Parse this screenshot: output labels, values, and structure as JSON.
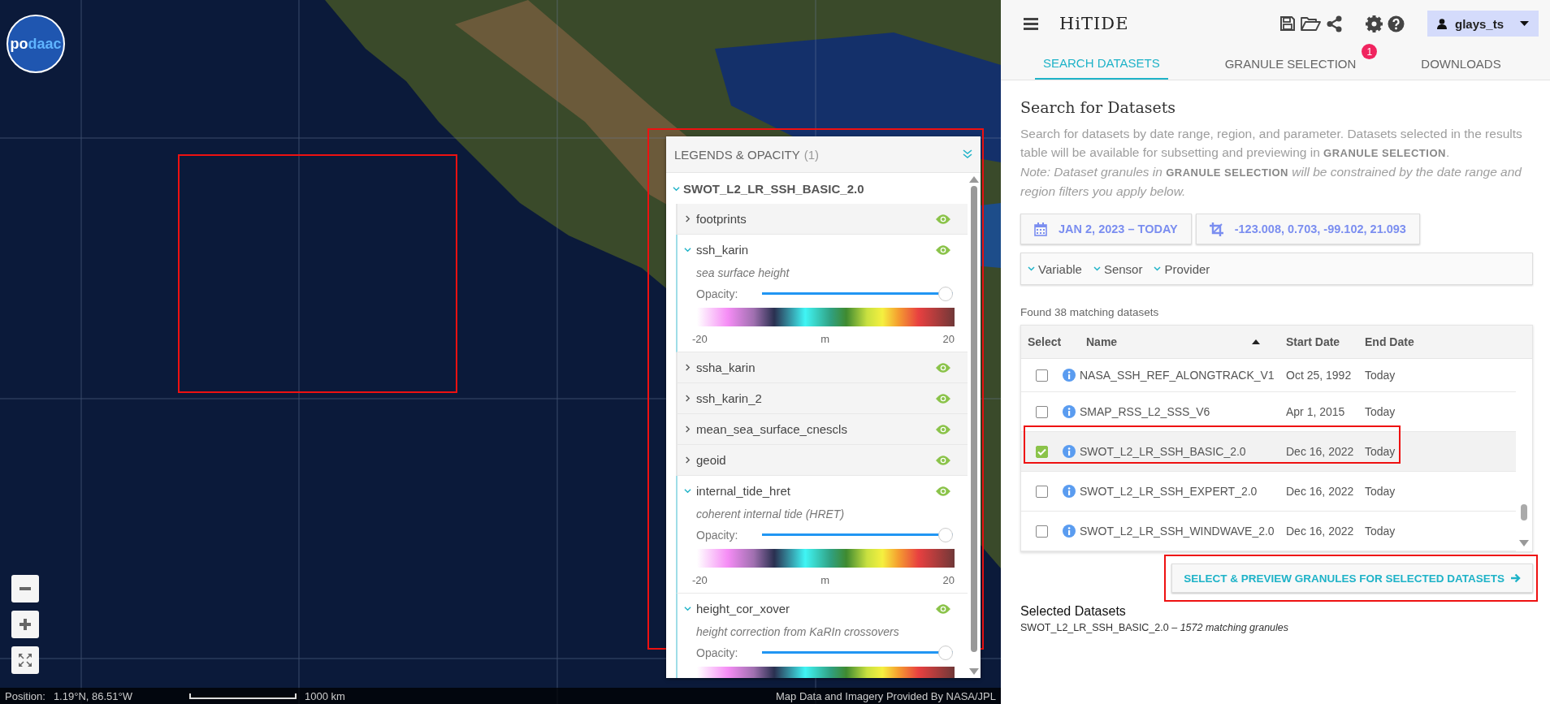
{
  "map": {
    "logo": [
      "po",
      "daac"
    ],
    "legend": {
      "title": "LEGENDS & OPACITY",
      "count": "(1)",
      "dataset": {
        "name": "SWOT_L2_LR_SSH_BASIC_2.0",
        "expanded": true
      },
      "layers": [
        {
          "name": "footprints",
          "expanded": false
        },
        {
          "name": "ssh_karin",
          "expanded": true,
          "description": "sea surface height",
          "opacity_label": "Opacity:",
          "level": 1,
          "min": "-20",
          "unit": "m",
          "max": "20"
        },
        {
          "name": "ssha_karin",
          "expanded": false
        },
        {
          "name": "ssh_karin_2",
          "expanded": false
        },
        {
          "name": "mean_sea_surface_cnescls",
          "expanded": false
        },
        {
          "name": "geoid",
          "expanded": false
        },
        {
          "name": "internal_tide_hret",
          "expanded": true,
          "description": "coherent internal tide (HRET)",
          "opacity_label": "Opacity:",
          "level": 1,
          "min": "-20",
          "unit": "m",
          "max": "20"
        },
        {
          "name": "height_cor_xover",
          "expanded": true,
          "description": "height correction from KaRIn crossovers",
          "opacity_label": "Opacity:",
          "level": 1
        }
      ]
    },
    "status_bar": {
      "position_label": "Position:",
      "position": "1.19°N, 86.51°W",
      "scale": "1000 km",
      "attribution": "Map Data and Imagery Provided By NASA/JPL"
    }
  },
  "header": {
    "title": "HiTIDE",
    "user": "glays_ts"
  },
  "tabs": [
    {
      "label": "SEARCH DATASETS",
      "selected": true
    },
    {
      "label": "GRANULE SELECTION",
      "selected": false,
      "badge": "1"
    },
    {
      "label": "DOWNLOADS",
      "selected": false
    }
  ],
  "search": {
    "title": "Search for Datasets",
    "description": "Search for datasets by date range, region, and parameter. Datasets selected in the results table will be available for subsetting and previewing in **GRANULE SELECTION**.",
    "note": "Note: Dataset granules in **GRANULE SELECTION** will be constrained by the date range and region filters you apply below.",
    "date_range": "JAN 2, 2023 – TODAY",
    "region": "-123.008, 0.703, -99.102, 21.093",
    "facets": [
      "Variable",
      "Sensor",
      "Provider"
    ]
  },
  "results": {
    "count": "Found 38 matching datasets",
    "columns": [
      "Select",
      "Name",
      "Start Date",
      "End Date"
    ],
    "rows": [
      {
        "name": "NASA_SSH_REF_ALONGTRACK_V1",
        "start": "Oct 25, 1992",
        "end": "Today",
        "checked": false
      },
      {
        "name": "SMAP_RSS_L2_SSS_V6",
        "start": "Apr 1, 2015",
        "end": "Today",
        "checked": false
      },
      {
        "name": "SWOT_L2_LR_SSH_BASIC_2.0",
        "start": "Dec 16, 2022",
        "end": "Today",
        "checked": true
      },
      {
        "name": "SWOT_L2_LR_SSH_EXPERT_2.0",
        "start": "Dec 16, 2022",
        "end": "Today",
        "checked": false
      },
      {
        "name": "SWOT_L2_LR_SSH_WINDWAVE_2.0",
        "start": "Dec 16, 2022",
        "end": "Today",
        "checked": false
      }
    ]
  },
  "action_button": "SELECT & PREVIEW GRANULES FOR SELECTED DATASETS",
  "selected": {
    "title": "Selected Datasets",
    "items": [
      "SWOT_L2_LR_SSH_BASIC_2.0 – *1572 matching granules*"
    ]
  }
}
